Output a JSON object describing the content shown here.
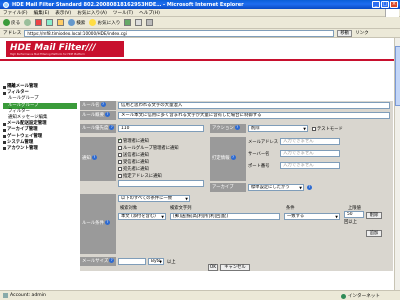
{
  "window": {
    "title": "HDE Mail Filter Standard 802.20080818162953HDE… - Microsoft Internet Explorer",
    "minimize": "_",
    "maximize": "□",
    "close": "×"
  },
  "menubar": [
    "ファイル(F)",
    "編集(E)",
    "表示(V)",
    "お気に入り(A)",
    "ツール(T)",
    "ヘルプ(H)"
  ],
  "toolbar": {
    "back": "戻る",
    "forward": "→",
    "search": "検索",
    "favorites": "お気に入り"
  },
  "address": {
    "label": "アドレス",
    "url": "https://mf8.timiodeo.local:10000/HDE/index.cgi",
    "go": "移動",
    "links": "リンク"
  },
  "logo": {
    "name": "HDE Mail Filter///",
    "tagline": "High Performance Mail Filtering Platform for HDE Platform"
  },
  "nav": [
    {
      "label": "隔離メール管理",
      "level": 1
    },
    {
      "label": "フィルター",
      "level": 1
    },
    {
      "label": "ルールグループ",
      "level": 2
    },
    {
      "label": "ルールグループ",
      "level": 2,
      "selected": true
    },
    {
      "label": "フィルター",
      "level": 2
    },
    {
      "label": "通知メッセージ編集",
      "level": 2
    },
    {
      "label": "メール配送設定管理",
      "level": 1
    },
    {
      "label": "アーカイブ管理",
      "level": 1
    },
    {
      "label": "ゲートウェイ管理",
      "level": 1
    },
    {
      "label": "システム管理",
      "level": 1
    },
    {
      "label": "アカウント管理",
      "level": 1
    }
  ],
  "form": {
    "rule_name_label": "ルール名",
    "rule_name_value": "信用と思われる文字の大量混入",
    "rule_summary_label": "ルール概要",
    "rule_summary_value": "メール本文に信用に多く含まれる文字が大量に含有した場合に制御する",
    "priority_label": "ルール優先度",
    "priority_value": "110",
    "action_label": "アクション",
    "action_value": "削除",
    "test_mode_label": "テストモード",
    "notify_label": "通知",
    "notify_opts": [
      "管理者に通知",
      "ルールグループ管理者に通知",
      "送信者に通知",
      "受信者に通知",
      "宛先者に通知",
      "指定アドレスに通知"
    ],
    "forward_label": "打定情報",
    "mail_address_label": "メールアドレス",
    "mail_address_ph": "入力できません",
    "server_label": "サーバー名",
    "server_ph": "入力できません",
    "port_label": "ポート番号",
    "port_ph": "入力できません",
    "archive_label": "アーカイブ",
    "archive_value": "標準設定にしたがう",
    "condition_label": "ルール条件",
    "condition_mode": "以下のすべての条件に一致",
    "target_header": "検索対象",
    "keyword_header": "検索文字列",
    "cond_header": "条件",
    "count_header": "上限値",
    "target_value": "本文 (添付を含む)",
    "keyword_value": "[郵]送|振|高|利|所|利|回|配]",
    "cond_value": "一致する",
    "count_value": "50",
    "count_unit": "回以上",
    "delete_btn": "削除",
    "add_btn": "追加",
    "mail_size_label": "メールサイズ",
    "mail_size_unit": "Byte",
    "mail_size_cond": "以上",
    "ok_btn": "OK",
    "cancel_btn": "キャンセル"
  },
  "status": {
    "left": "Account: admin",
    "zone": "インターネット"
  }
}
